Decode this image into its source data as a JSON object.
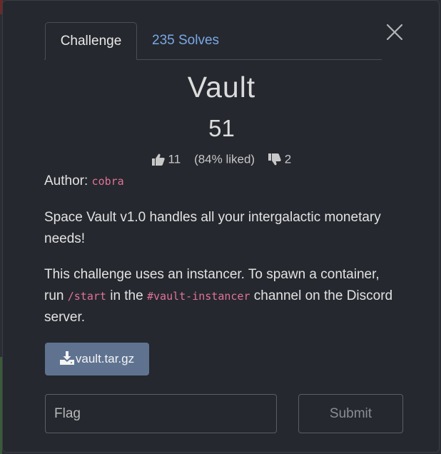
{
  "tabs": {
    "challenge": "Challenge",
    "solves": "235 Solves"
  },
  "challenge": {
    "name": "Vault",
    "points": "51",
    "likes": "11",
    "liked_percent": "(84% liked)",
    "dislikes": "2",
    "author_label": "Author:",
    "author": "cobra"
  },
  "description": {
    "line1": "Space Vault v1.0 handles all your intergalactic monetary needs!",
    "p2_before": "This challenge uses an instancer. To spawn a container, run ",
    "p2_cmd": "/start",
    "p2_mid": " in the ",
    "p2_channel": "#vault-instancer",
    "p2_after": " channel on the Discord server."
  },
  "download": {
    "label": "vault.tar.gz"
  },
  "flag": {
    "placeholder": "Flag",
    "value": ""
  },
  "submit": {
    "label": "Submit"
  },
  "colors": {
    "link": "#79a8e6",
    "code": "#e1729a",
    "button": "#5f7391"
  }
}
